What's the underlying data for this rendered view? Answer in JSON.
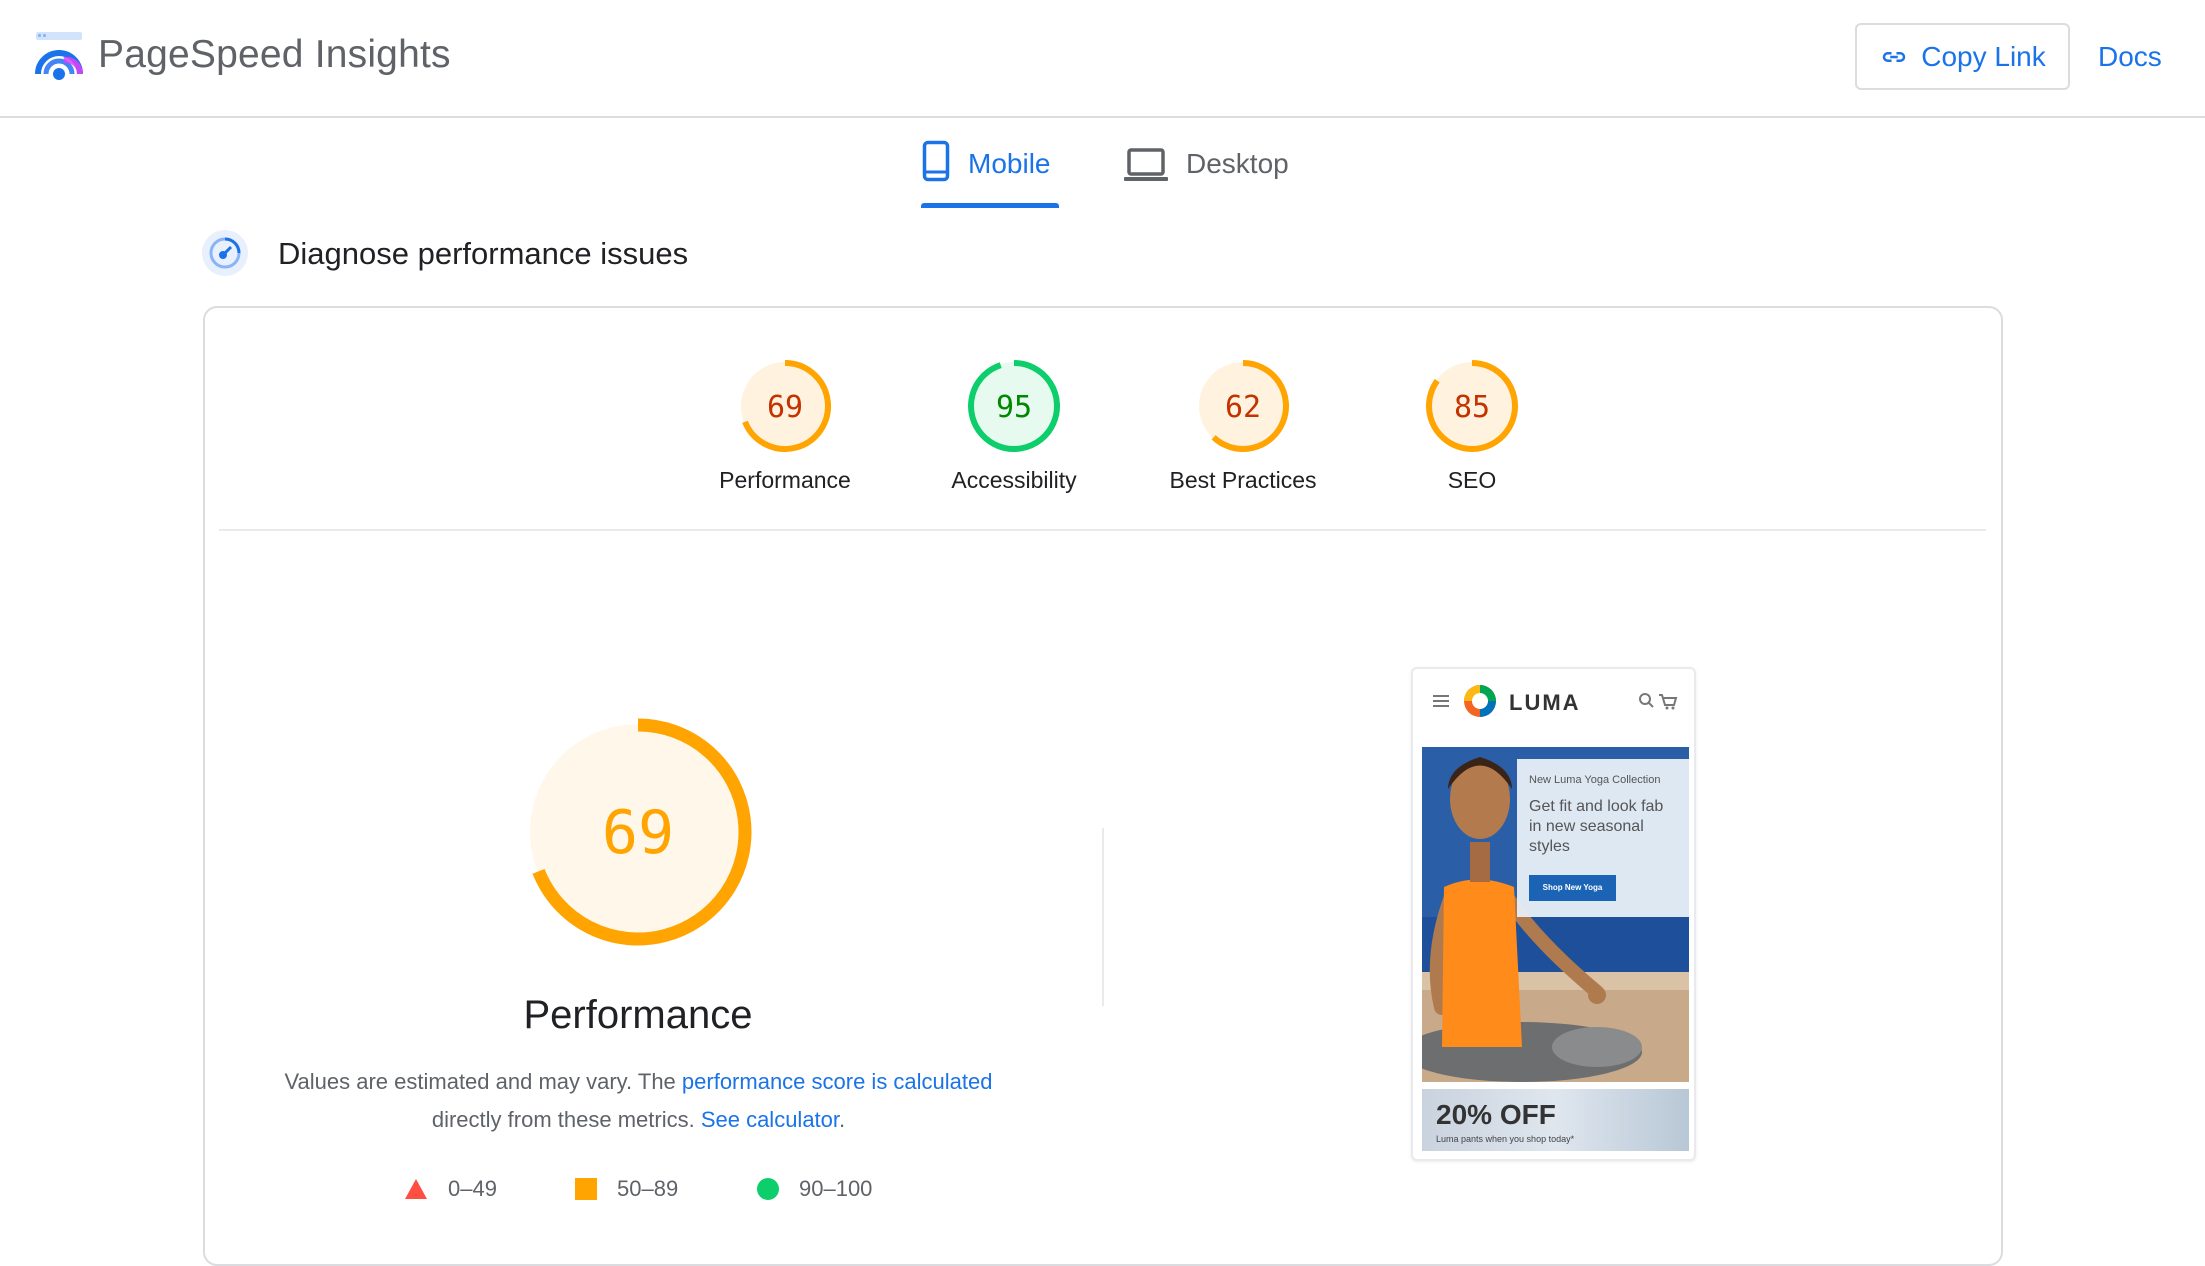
{
  "header": {
    "app_title": "PageSpeed Insights",
    "copy_link_label": "Copy Link",
    "docs_label": "Docs"
  },
  "tabs": [
    {
      "label": "Mobile",
      "active": true
    },
    {
      "label": "Desktop",
      "active": false
    }
  ],
  "section": {
    "title": "Diagnose performance issues"
  },
  "scores": [
    {
      "label": "Performance",
      "value": 69,
      "status": "average"
    },
    {
      "label": "Accessibility",
      "value": 95,
      "status": "pass"
    },
    {
      "label": "Best Practices",
      "value": 62,
      "status": "average"
    },
    {
      "label": "SEO",
      "value": 85,
      "status": "average"
    }
  ],
  "performance": {
    "value": 69,
    "title": "Performance",
    "desc_prefix": "Values are estimated and may vary. The ",
    "desc_link1": "performance score is calculated",
    "desc_middle": " directly from these metrics. ",
    "desc_link2": "See calculator",
    "desc_suffix": "."
  },
  "legend": [
    {
      "range": "0–49",
      "shape": "triangle",
      "color": "#ff4e42"
    },
    {
      "range": "50–89",
      "shape": "square",
      "color": "#ffa400"
    },
    {
      "range": "90–100",
      "shape": "circle",
      "color": "#0cce6b"
    }
  ],
  "screenshot": {
    "brand": "LUMA",
    "kicker": "New Luma Yoga Collection",
    "headline": "Get fit and look fab in new seasonal styles",
    "cta": "Shop New Yoga",
    "promo_title": "20% OFF",
    "promo_sub": "Luma pants when you shop today*"
  },
  "colors": {
    "accent": "#1a73e8",
    "average": "#ffa400",
    "average_text": "#c33300",
    "average_bg": "#fff3e0",
    "pass": "#0cce6b",
    "pass_text": "#008800",
    "pass_bg": "#e6faf0"
  },
  "icons": {
    "logo": "pagespeed-gauge-icon",
    "copy": "link-icon",
    "mobile_tab": "smartphone-icon",
    "desktop_tab": "laptop-icon",
    "diagnose": "speedometer-icon"
  }
}
